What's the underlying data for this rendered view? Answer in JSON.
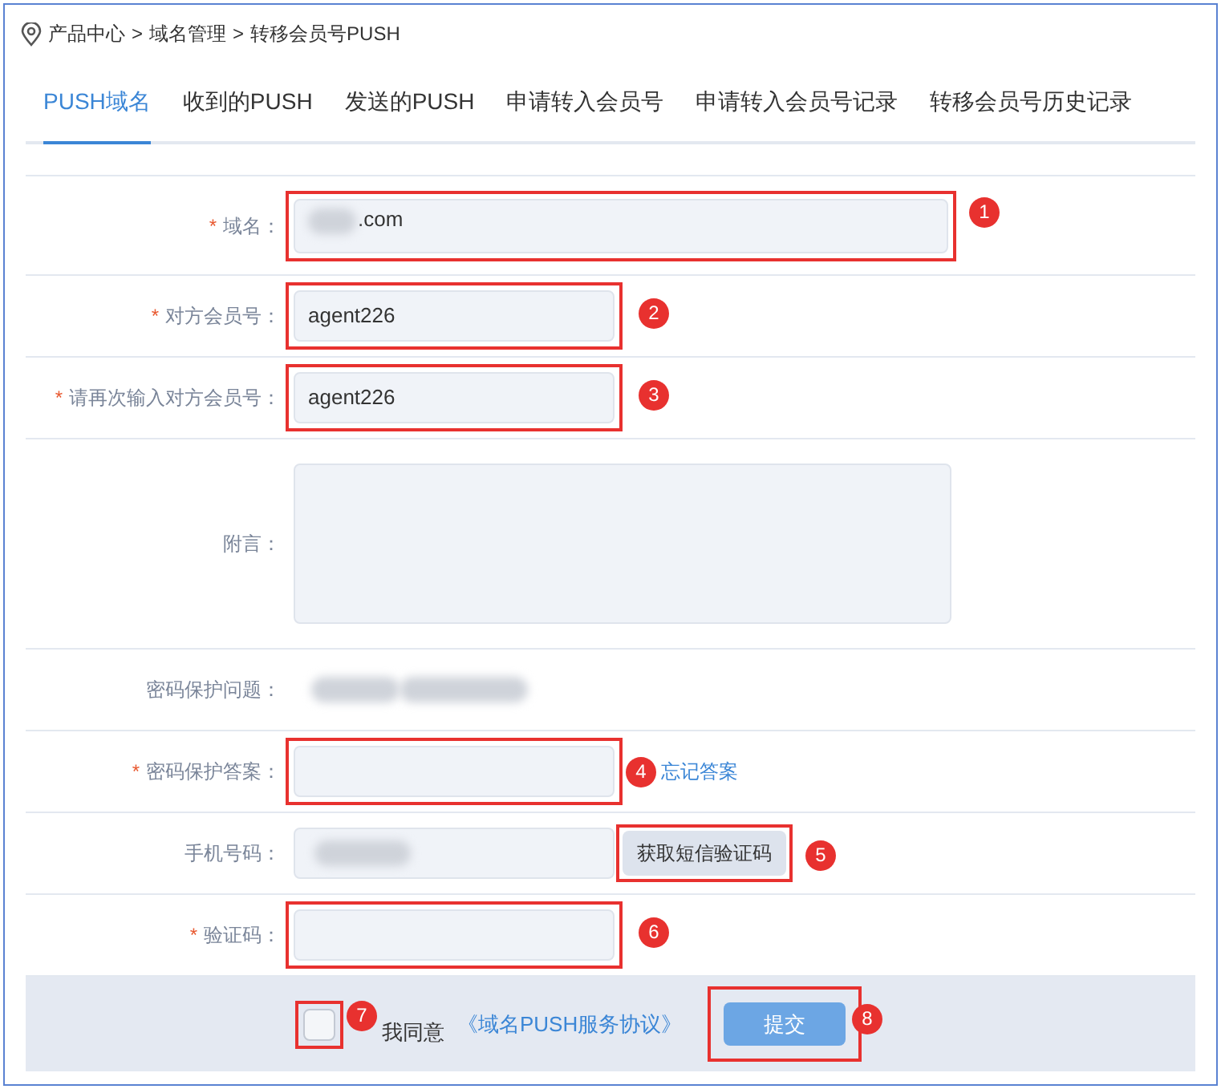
{
  "breadcrumb": [
    "产品中心",
    "域名管理",
    "转移会员号PUSH"
  ],
  "breadcrumb_separator": ">",
  "tabs": [
    {
      "label": "PUSH域名",
      "selected": true
    },
    {
      "label": "收到的PUSH",
      "selected": false
    },
    {
      "label": "发送的PUSH",
      "selected": false
    },
    {
      "label": "申请转入会员号",
      "selected": false
    },
    {
      "label": "申请转入会员号记录",
      "selected": false
    },
    {
      "label": "转移会员号历史记录",
      "selected": false
    }
  ],
  "required_mark": "*",
  "rows": [
    {
      "kind": "textarea",
      "label": "域名：",
      "required": true,
      "value": ".com",
      "blurred_prefix": true,
      "marker": "1"
    },
    {
      "kind": "input",
      "label": "对方会员号：",
      "required": true,
      "value": "agent226",
      "marker": "2"
    },
    {
      "kind": "input",
      "label": "请再次输入对方会员号：",
      "required": true,
      "value": "agent226",
      "marker": "3"
    },
    {
      "kind": "bigtextarea",
      "label": "附言：",
      "required": false
    },
    {
      "kind": "blurred",
      "label": "密码保护问题：",
      "required": false
    },
    {
      "kind": "input",
      "label": "密码保护答案：",
      "required": true,
      "marker": "4",
      "link": "忘记答案"
    },
    {
      "kind": "phone",
      "label": "手机号码：",
      "required": false,
      "button": "获取短信验证码",
      "marker": "5"
    },
    {
      "kind": "input",
      "label": "验证码：",
      "required": true,
      "marker": "6"
    }
  ],
  "footer": {
    "checkbox": {
      "checked": false,
      "marker": "7"
    },
    "agree_text": "我同意",
    "agreement_link": "《域名PUSH服务协议》",
    "submit": "提交",
    "submit_marker": "8"
  }
}
